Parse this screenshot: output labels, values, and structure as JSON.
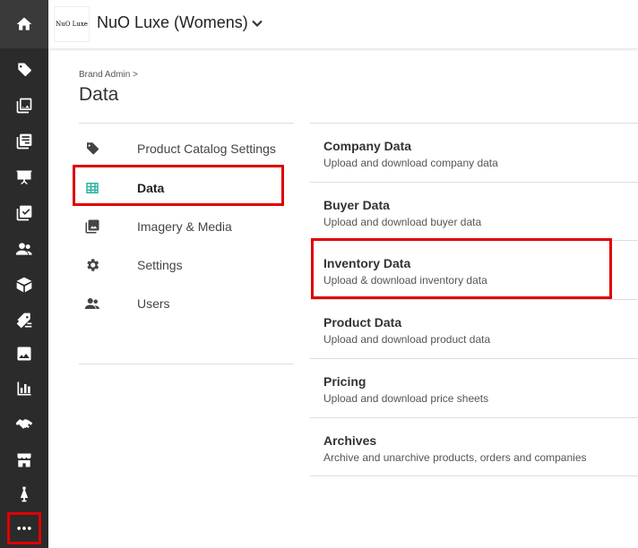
{
  "brand": {
    "logo_text": "NuO Luxe",
    "name": "NuO Luxe (Womens)"
  },
  "rail": {
    "icons": [
      "home-icon",
      "tag-icon",
      "images-icon",
      "catalog-icon",
      "presentation-icon",
      "checklist-icon",
      "users-icon",
      "box-icon",
      "tags-discount-icon",
      "gallery-icon",
      "bar-chart-icon",
      "handshake-icon",
      "storefront-icon",
      "dress-form-icon",
      "more-icon"
    ]
  },
  "breadcrumb": "Brand Admin >",
  "page_title": "Data",
  "nav": [
    {
      "label": "Product Catalog Settings",
      "icon": "tag-icon"
    },
    {
      "label": "Data",
      "icon": "table-icon"
    },
    {
      "label": "Imagery & Media",
      "icon": "image-icon"
    },
    {
      "label": "Settings",
      "icon": "gear-icon"
    },
    {
      "label": "Users",
      "icon": "users-icon"
    }
  ],
  "sections": [
    {
      "title": "Company Data",
      "desc": "Upload and download company data"
    },
    {
      "title": "Buyer Data",
      "desc": "Upload and download buyer data"
    },
    {
      "title": "Inventory Data",
      "desc": "Upload & download inventory data"
    },
    {
      "title": "Product Data",
      "desc": "Upload and download product data"
    },
    {
      "title": "Pricing",
      "desc": "Upload and download price sheets"
    },
    {
      "title": "Archives",
      "desc": "Archive and unarchive products, orders and companies"
    }
  ],
  "colors": {
    "rail": "#2b2b2b",
    "highlight": "#e00000",
    "table_icon": "#2bb3a0"
  }
}
